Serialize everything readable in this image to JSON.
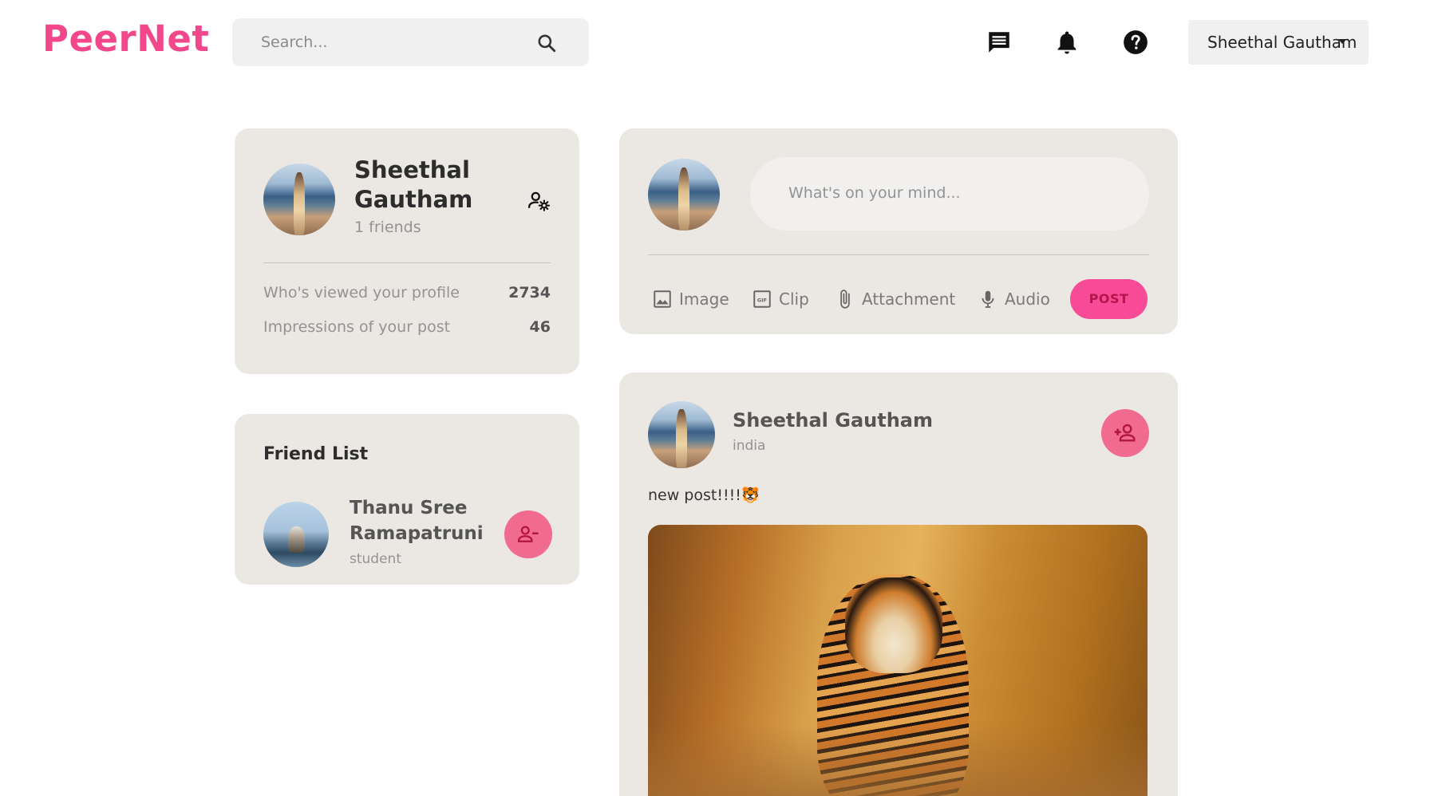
{
  "app": {
    "logo": "PeerNet"
  },
  "search": {
    "placeholder": "Search..."
  },
  "user_menu": {
    "selected": "Sheethal Gautham"
  },
  "profile_card": {
    "name": "Sheethal Gautham",
    "friends": "1 friends",
    "stats": [
      {
        "label": "Who's viewed your profile",
        "value": "2734"
      },
      {
        "label": "Impressions of your post",
        "value": "46"
      }
    ]
  },
  "friend_list": {
    "title": "Friend List",
    "friends": [
      {
        "name": "Thanu Sree Ramapatruni",
        "occupation": "student"
      }
    ]
  },
  "composer": {
    "placeholder": "What's on your mind...",
    "tools": [
      "Image",
      "Clip",
      "Attachment",
      "Audio"
    ],
    "post_label": "POST"
  },
  "feed": {
    "posts": [
      {
        "author": "Sheethal Gautham",
        "location": "india",
        "text": "new post!!!!🐯"
      }
    ]
  },
  "colors": {
    "brand": "#f2478b",
    "card": "#ebe7e2",
    "accent_button": "#f06b8d"
  },
  "icons": [
    "search-icon",
    "message-icon",
    "bell-icon",
    "help-icon",
    "manage-account-icon",
    "image-icon",
    "gif-icon",
    "attachment-icon",
    "mic-icon",
    "add-friend-icon",
    "remove-friend-icon"
  ]
}
